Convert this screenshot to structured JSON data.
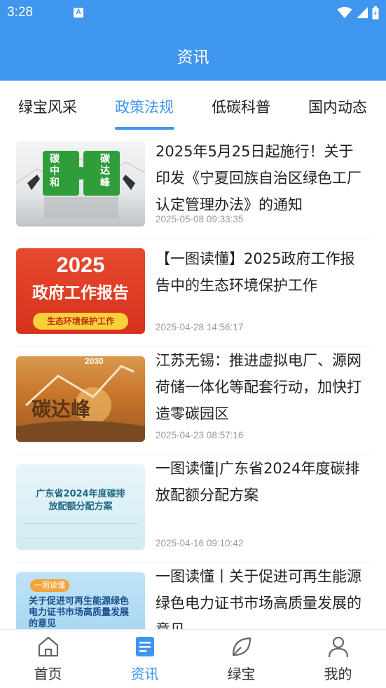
{
  "status_bar": {
    "time": "3:28",
    "app_icon": "A"
  },
  "header": {
    "title": "资讯"
  },
  "tabs": [
    {
      "label": "绿宝风采",
      "active": false
    },
    {
      "label": "政策法规",
      "active": true
    },
    {
      "label": "低碳科普",
      "active": false
    },
    {
      "label": "国内动态",
      "active": false
    }
  ],
  "news": [
    {
      "title": "2025年5月25日起施行！关于印发《宁夏回族自治区绿色工厂认定管理办法》的通知",
      "date": "2025-05-08 09:33:35",
      "thumb": {
        "left_text": "碳中和",
        "right_text": "碳达峰"
      }
    },
    {
      "title": "【一图读懂】2025政府工作报告中的生态环境保护工作",
      "date": "2025-04-28 14:56:17",
      "thumb": {
        "year": "2025",
        "headline": "政府工作报告",
        "tag": "生态环境保护工作"
      }
    },
    {
      "title": "江苏无锡：推进虚拟电厂、源网荷储一体化等配套行动，加快打造零碳园区",
      "date": "2025-04-23 08:57:16",
      "thumb": {
        "year": "2030",
        "headline": "碳达峰"
      }
    },
    {
      "title": "一图读懂|广东省2024年度碳排放配额分配方案",
      "date": "2025-04-16 09:10:42",
      "thumb": {
        "headline": "广东省2024年度碳排放配额分配方案"
      }
    },
    {
      "title": "一图读懂丨关于促进可再生能源绿色电力证书市场高质量发展的意见",
      "date": "",
      "thumb": {
        "tag": "一图读懂",
        "headline": "关于促进可再生能源绿色电力证书市场高质量发展的意见"
      }
    }
  ],
  "bottom_nav": [
    {
      "label": "首页",
      "icon": "home-icon",
      "active": false
    },
    {
      "label": "资讯",
      "icon": "news-icon",
      "active": true
    },
    {
      "label": "绿宝",
      "icon": "leaf-icon",
      "active": false
    },
    {
      "label": "我的",
      "icon": "profile-icon",
      "active": false
    }
  ],
  "colors": {
    "primary": "#3f96ee",
    "text": "#222222",
    "date": "#9a9a9a"
  }
}
